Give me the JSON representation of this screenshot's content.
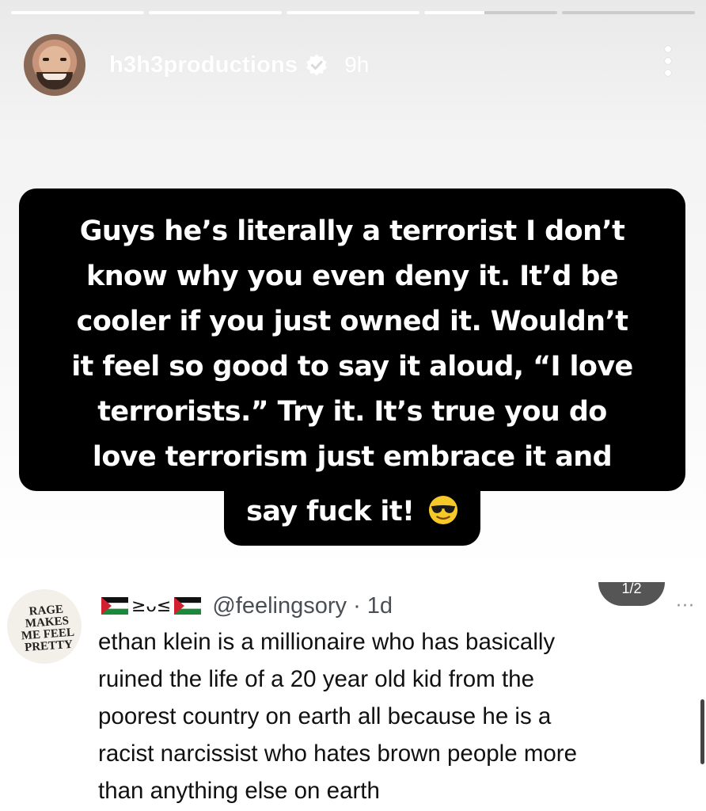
{
  "story": {
    "progress_segments": [
      1,
      1,
      1,
      0.45,
      0
    ]
  },
  "header": {
    "username": "h3h3productions",
    "time_ago": "9h",
    "verified_icon": "verified-badge-icon",
    "menu_icon": "more-vertical-icon"
  },
  "caption": {
    "lines": [
      "Guys he’s literally a terrorist I don’t",
      "know why you even deny it. It’d be",
      "cooler if you just owned it. Wouldn’t",
      "it feel so good to say it aloud, “I love",
      "terrorists.” Try it. It’s true you do",
      "love terrorism just embrace it and"
    ],
    "last_line": "say fuck it!",
    "emoji": "smiling-face-with-sunglasses"
  },
  "tweet": {
    "avatar_text": "RAGE\nMAKES\nME FEEL\nPRETTY",
    "name_glyphs": "≥ᴗ≤",
    "handle_time": "@feelingsory · 1d",
    "pager": "1/2",
    "more": "···",
    "body_lines": [
      "ethan klein is a millionaire who has basically",
      "ruined the life of a 20 year old kid from the",
      "poorest country on earth all because he is a",
      "racist narcissist who hates brown people more",
      "than anything else on earth"
    ]
  },
  "colors": {
    "caption_bg": "#000000",
    "caption_text": "#ffffff",
    "handle": "#4a4f55",
    "tweet_text": "#111111"
  }
}
